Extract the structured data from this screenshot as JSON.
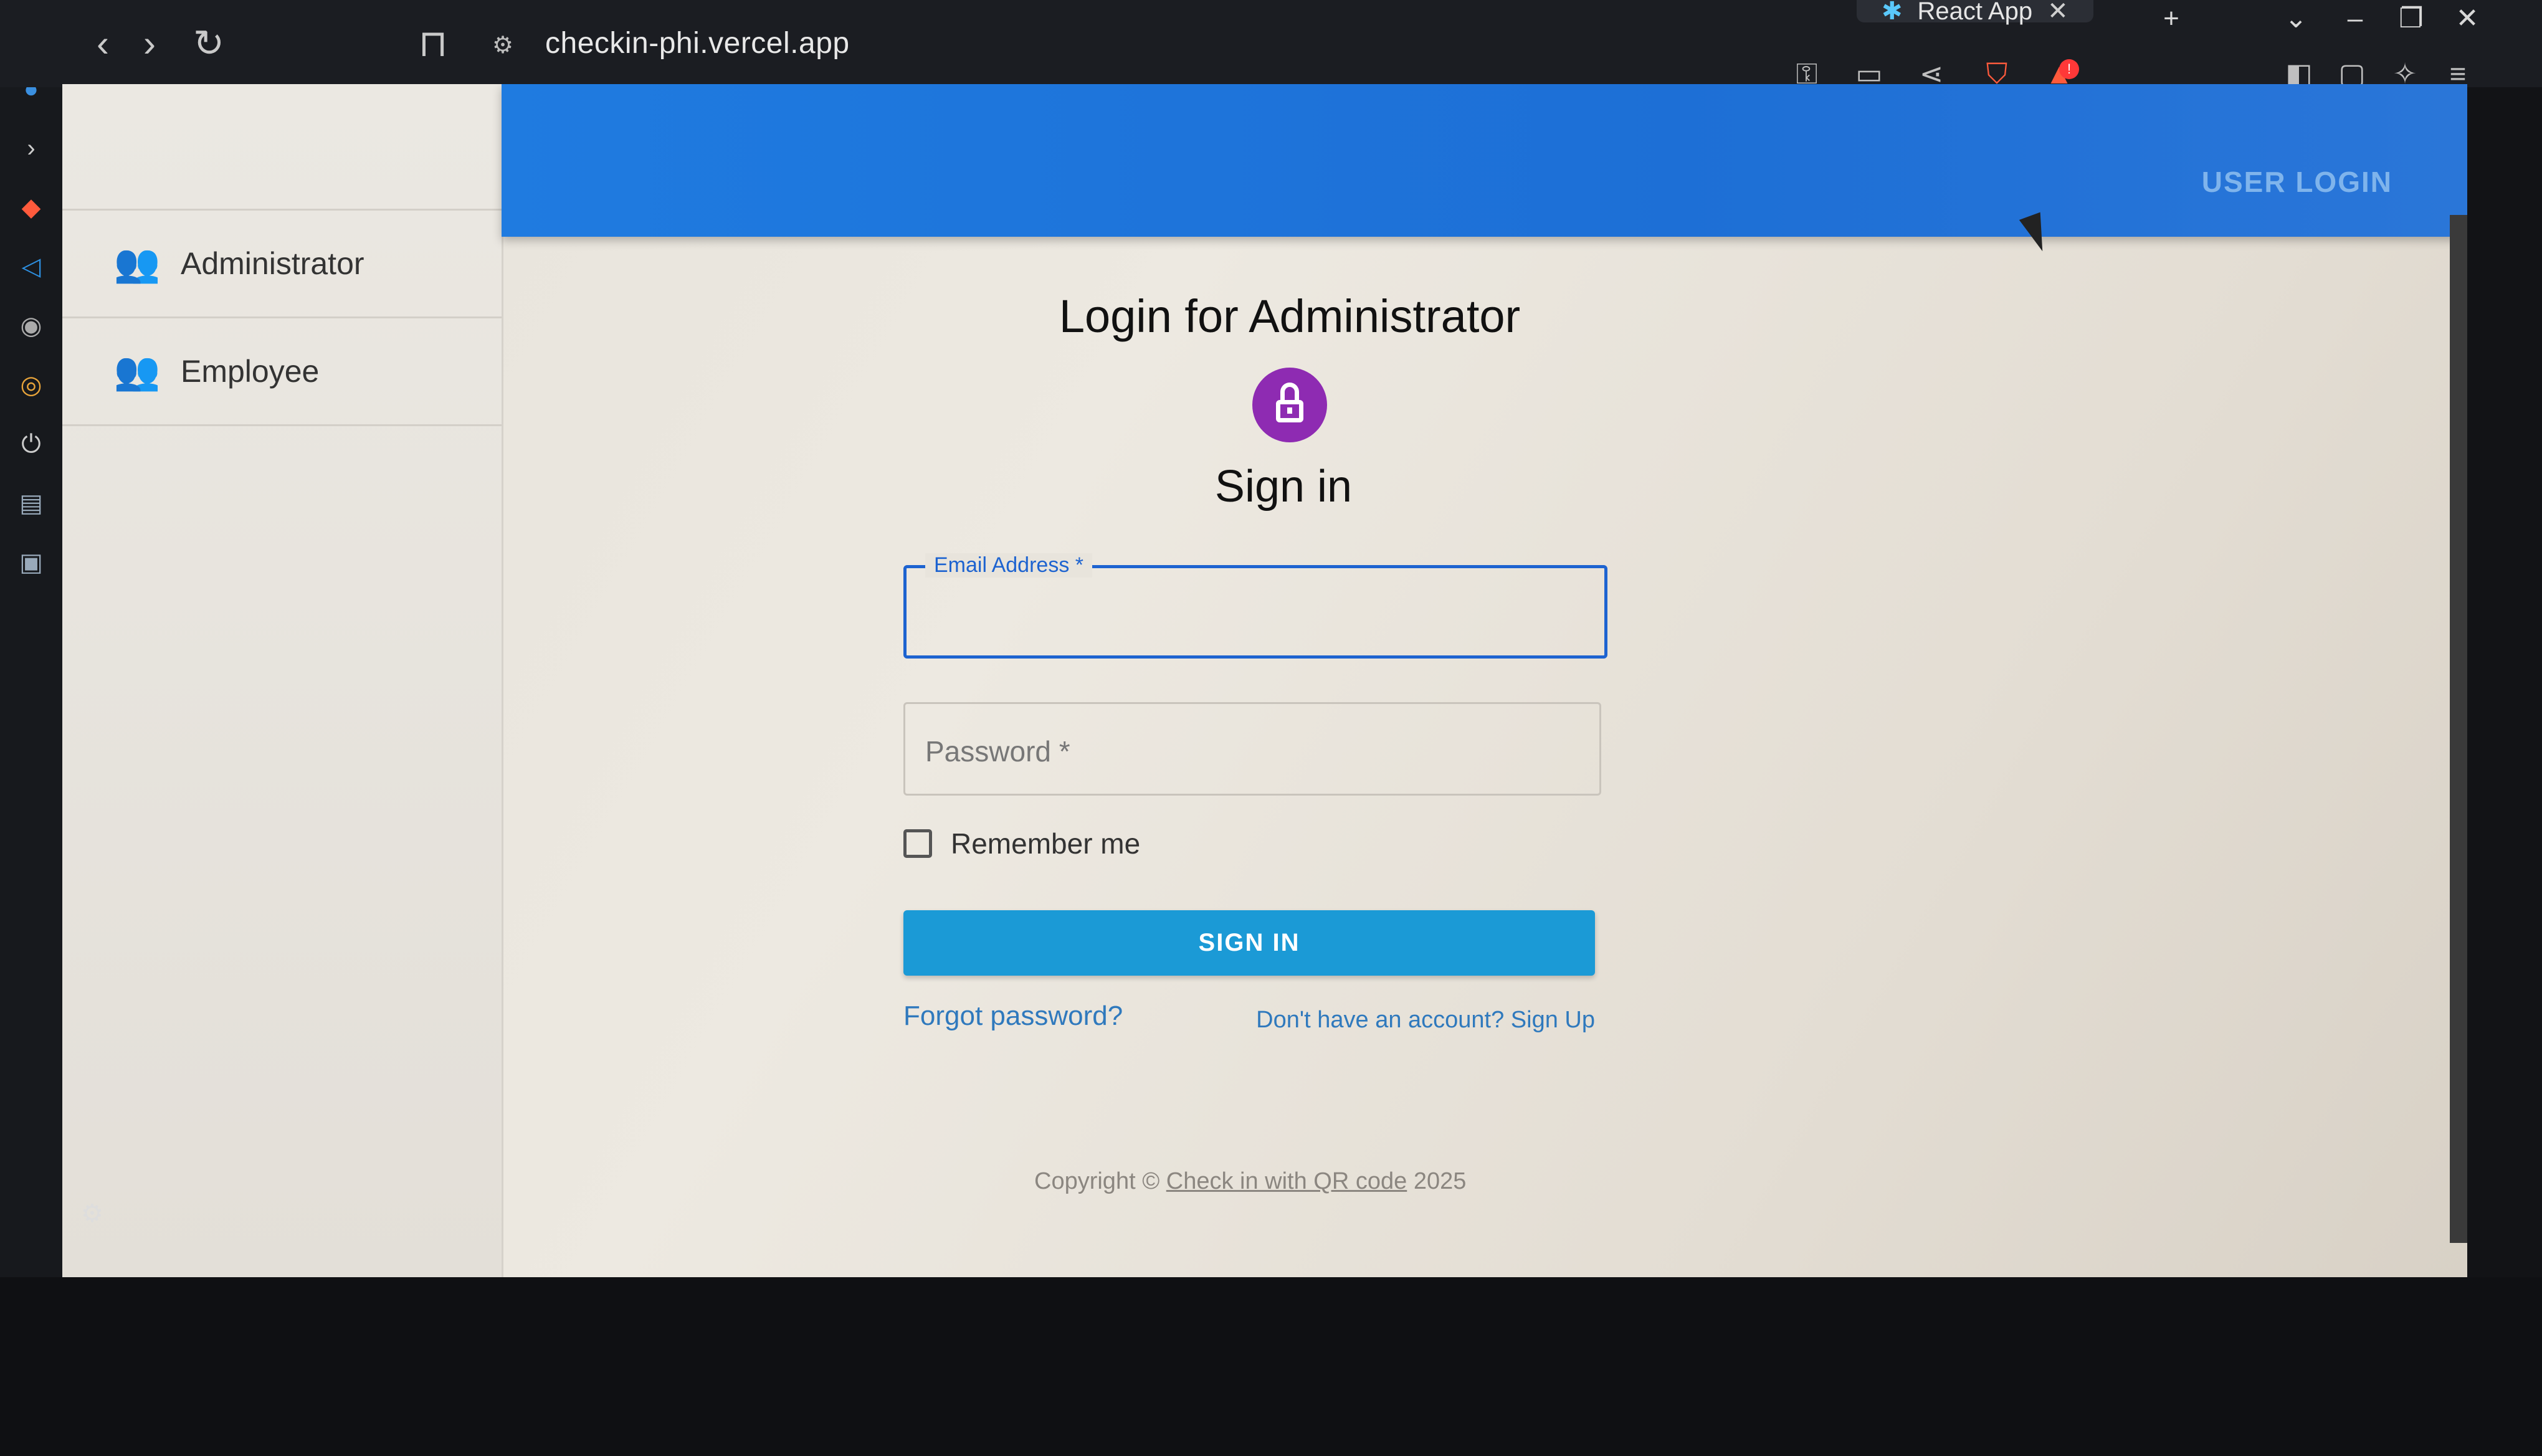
{
  "browser": {
    "tabs": [
      {
        "label": "React App"
      }
    ],
    "url": "checkin-phi.vercel.app"
  },
  "sidebar": {
    "items": [
      {
        "label": "Administrator",
        "icon": "admin-users-icon"
      },
      {
        "label": "Employee",
        "icon": "people-icon"
      }
    ]
  },
  "appbar": {
    "user_login_label": "USER LOGIN",
    "color": "#1f7be0"
  },
  "login": {
    "title": "Login for Administrator",
    "heading": "Sign in",
    "email_label": "Email Address *",
    "email_value": "",
    "password_placeholder": "Password *",
    "remember_label": "Remember me",
    "signin_label": "SIGN IN",
    "forgot_label": "Forgot password?",
    "signup_label": "Don't have an account? Sign Up",
    "lock_color": "#8e2bb2",
    "button_color": "#1b9ad6"
  },
  "footer": {
    "prefix": "Copyright ©",
    "link": "Check in with QR code",
    "year": "2025"
  }
}
